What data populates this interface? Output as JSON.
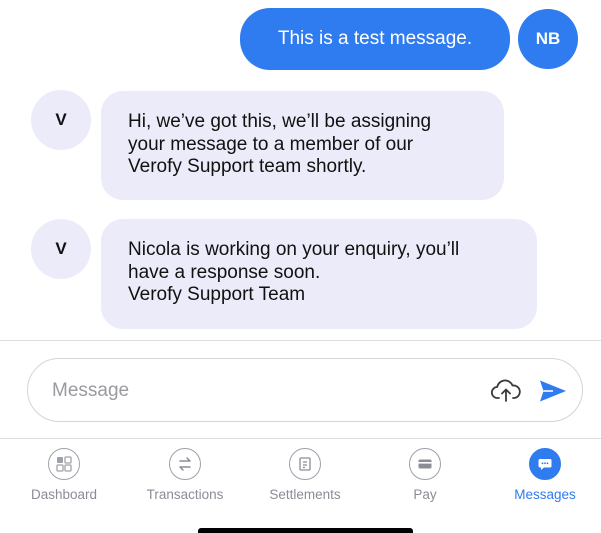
{
  "conversation": {
    "outgoing": {
      "text": "This is a test message.",
      "avatar_initials": "NB"
    },
    "incoming": [
      {
        "avatar_initial": "V",
        "lines": [
          "Hi, we’ve got this, we’ll be assigning",
          "your message to a member of our",
          "Verofy Support team shortly."
        ]
      },
      {
        "avatar_initial": "V",
        "lines": [
          "Nicola is working on your enquiry, you’ll",
          "have a response soon.",
          "Verofy Support Team"
        ]
      }
    ]
  },
  "composer": {
    "placeholder": "Message",
    "value": "",
    "upload_icon": "cloud-upload-icon",
    "send_icon": "send-icon"
  },
  "tab_bar": {
    "active_tab": "Messages",
    "tabs": [
      {
        "label": "Dashboard",
        "icon": "dashboard-icon"
      },
      {
        "label": "Transactions",
        "icon": "transactions-icon"
      },
      {
        "label": "Settlements",
        "icon": "settlements-icon"
      },
      {
        "label": "Pay",
        "icon": "pay-card-icon"
      },
      {
        "label": "Messages",
        "icon": "messages-icon"
      }
    ]
  },
  "colors": {
    "accent": "#2f7bf0",
    "incoming_bubble": "#ecebf9",
    "inactive_tab": "#8a8d96",
    "separator": "#dcdce2"
  }
}
